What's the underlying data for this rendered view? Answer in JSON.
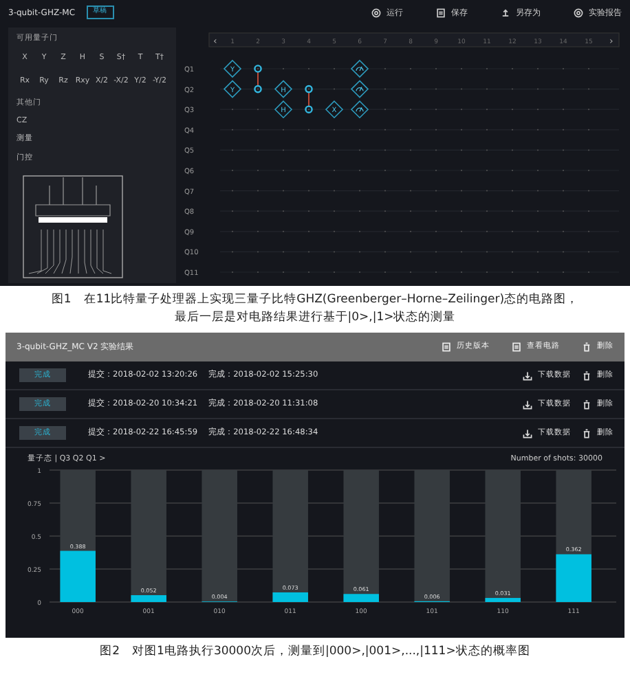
{
  "editor": {
    "title": "3-qubit-GHZ-MC",
    "status_badge": "草稿",
    "toolbar": [
      {
        "label": "运行",
        "kind": "run"
      },
      {
        "label": "保存",
        "kind": "save"
      },
      {
        "label": "另存为",
        "kind": "saveas"
      },
      {
        "label": "实验报告",
        "kind": "report"
      }
    ],
    "gate_panel": {
      "title": "可用量子门",
      "gate_rows": [
        [
          "X",
          "Y",
          "Z",
          "H",
          "S",
          "S†",
          "T",
          "T†"
        ],
        [
          "Rx",
          "Ry",
          "Rz",
          "Rxy",
          "X/2",
          "-X/2",
          "Y/2",
          "-Y/2"
        ]
      ],
      "other_title": "其他门",
      "other_gates": [
        "CZ",
        "测量",
        "门控"
      ]
    },
    "circuit": {
      "scroll_left": "‹",
      "scroll_right": "›",
      "columns": [
        "1",
        "2",
        "3",
        "4",
        "5",
        "6",
        "7",
        "8",
        "9",
        "10",
        "11",
        "12",
        "13",
        "14",
        "15"
      ],
      "qubits": [
        {
          "label": "Q1",
          "ops": [
            {
              "kind": "gate",
              "label": "Y"
            },
            {
              "kind": "cz",
              "connected_below": true
            },
            {
              "kind": "idle"
            },
            {
              "kind": "idle"
            },
            {
              "kind": "idle"
            },
            {
              "kind": "measure"
            }
          ]
        },
        {
          "label": "Q2",
          "ops": [
            {
              "kind": "gate",
              "label": "Y"
            },
            {
              "kind": "cz",
              "connected_below": false
            },
            {
              "kind": "gate",
              "label": "H"
            },
            {
              "kind": "cz",
              "connected_below": true
            },
            {
              "kind": "idle"
            },
            {
              "kind": "measure"
            }
          ]
        },
        {
          "label": "Q3",
          "ops": [
            {
              "kind": "idle"
            },
            {
              "kind": "idle"
            },
            {
              "kind": "gate",
              "label": "H"
            },
            {
              "kind": "cz",
              "connected_below": false
            },
            {
              "kind": "gate",
              "label": "X"
            },
            {
              "kind": "measure"
            }
          ]
        },
        {
          "label": "Q4"
        },
        {
          "label": "Q5"
        },
        {
          "label": "Q6"
        },
        {
          "label": "Q7"
        },
        {
          "label": "Q8"
        },
        {
          "label": "Q9"
        },
        {
          "label": "Q10"
        },
        {
          "label": "Q11"
        }
      ]
    }
  },
  "caption_1": [
    "图1　在11比特量子处理器上实现三量子比特GHZ(Greenberger–Horne–Zeilinger)态的电路图，",
    "最后一层是对电路结果进行基于|0>,|1>状态的测量"
  ],
  "results": {
    "title": "3-qubit-GHZ_MC V2 实验结果",
    "toolbar": [
      {
        "label": "历史版本",
        "kind": "history"
      },
      {
        "label": "查看电路",
        "kind": "circuit"
      },
      {
        "label": "删除",
        "kind": "delete"
      }
    ],
    "runs": [
      {
        "status": "完成",
        "submitted": "提交：2018-02-02 13:20:26",
        "finished": "完成：2018-02-02 15:25:30",
        "download": "下载数据",
        "delete": "删除"
      },
      {
        "status": "完成",
        "submitted": "提交：2018-02-20 10:34:21",
        "finished": "完成：2018-02-20 11:31:08",
        "download": "下载数据",
        "delete": "删除"
      },
      {
        "status": "完成",
        "submitted": "提交：2018-02-22 16:45:59",
        "finished": "完成：2018-02-22 16:48:34",
        "download": "下载数据",
        "delete": "删除"
      }
    ],
    "chart_label": "量子态 | Q3 Q2 Q1 >",
    "shots": "Number of shots: 30000",
    "chart_data": {
      "type": "bar",
      "categories": [
        "000",
        "001",
        "010",
        "011",
        "100",
        "101",
        "110",
        "111"
      ],
      "series": [
        {
          "color": "#00c0e0",
          "values": [
            0.388,
            0.052,
            0.004,
            0.073,
            0.061,
            0.006,
            0.031,
            0.362
          ]
        }
      ],
      "ylim": [
        0,
        1
      ],
      "yticks": [
        0,
        0.25,
        0.5,
        0.75,
        1
      ],
      "data_labels": true,
      "grid": true
    }
  },
  "caption_2": "图2　对图1电路执行30000次后，测量到|000>,|001>,...,|111>状态的概率图"
}
